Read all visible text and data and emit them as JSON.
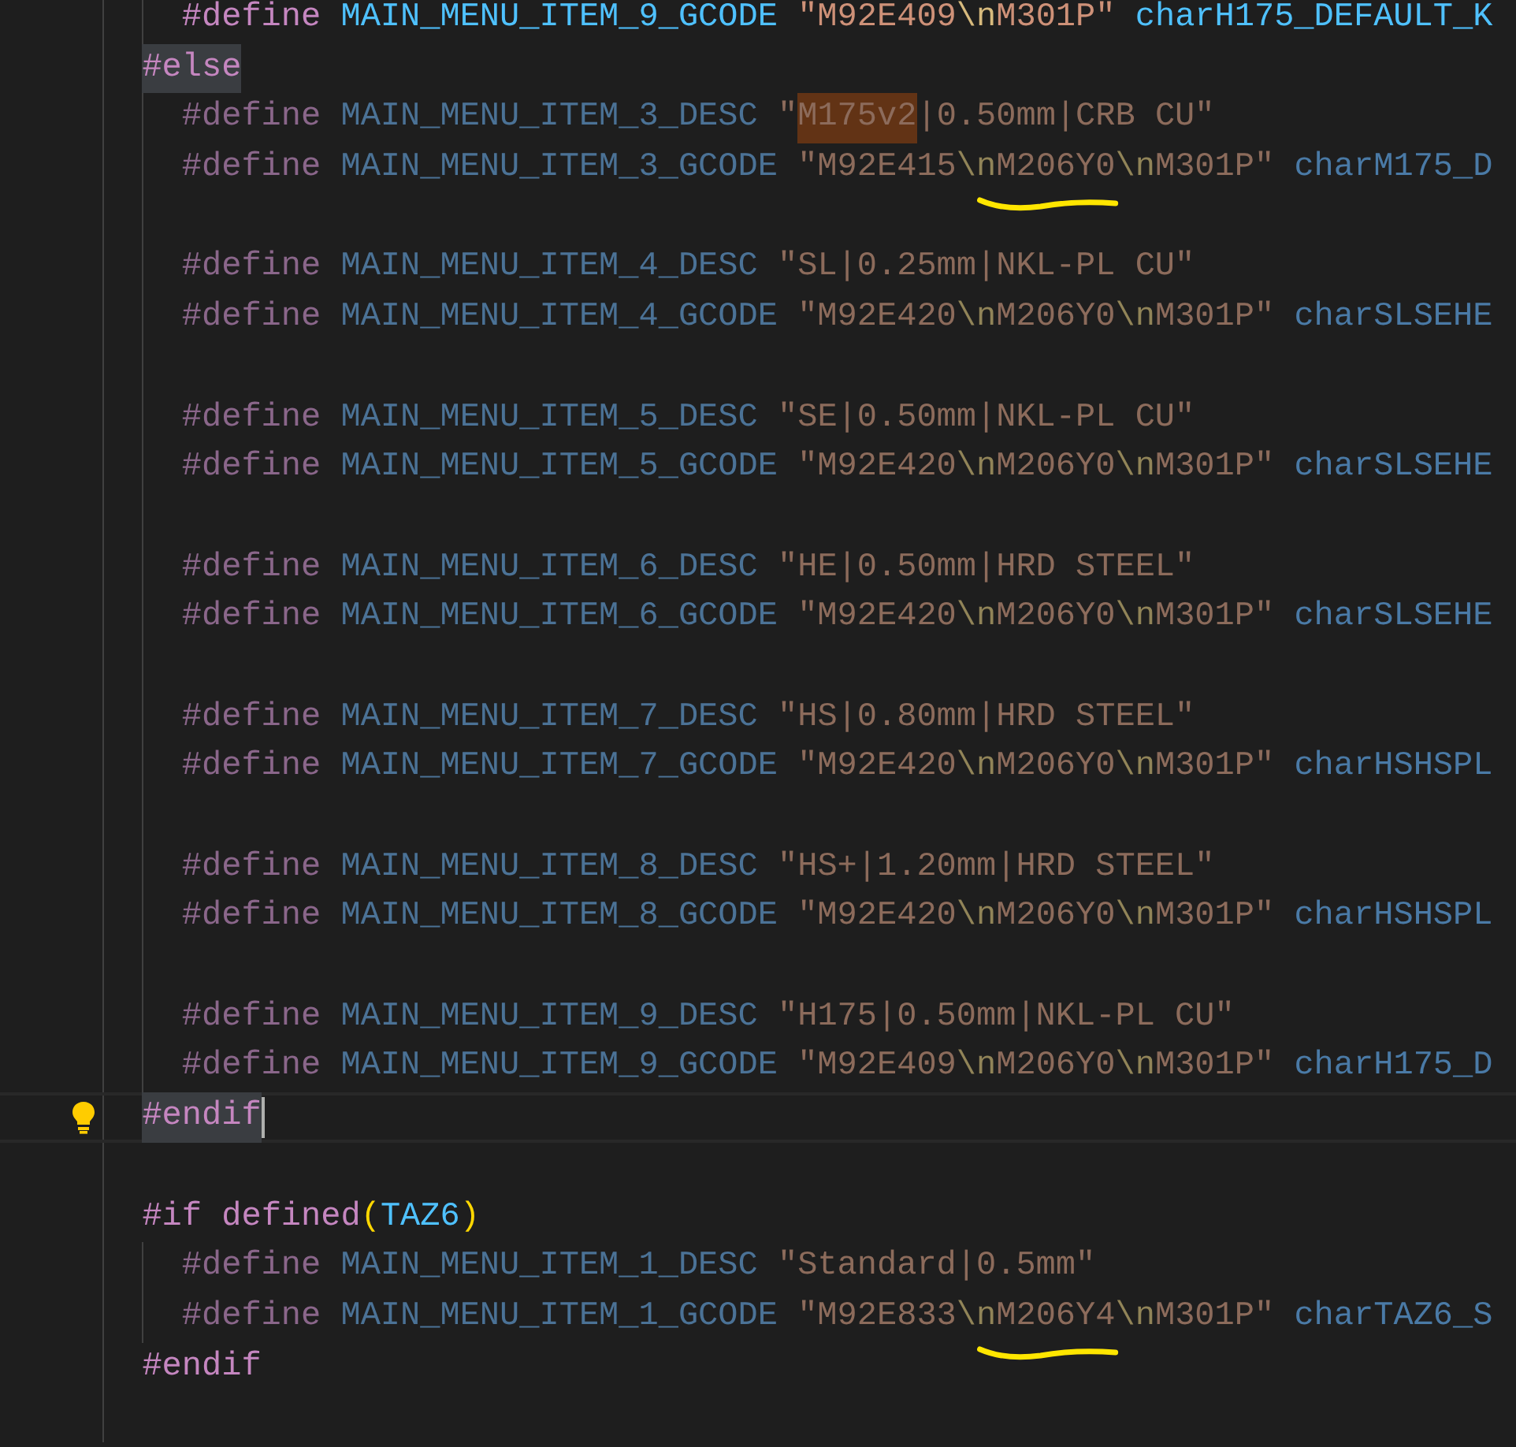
{
  "editor": {
    "lines": [
      {
        "kind": "code",
        "nested": true,
        "dimmed": false,
        "tokens": [
          {
            "kind": "directive",
            "text": "#define"
          },
          {
            "kind": "macro",
            "text": " MAIN_MENU_ITEM_9_GCODE"
          },
          {
            "kind": "string",
            "text": " \"M92E409"
          },
          {
            "kind": "escape",
            "text": "\\n"
          },
          {
            "kind": "string",
            "text": "M301P\""
          },
          {
            "kind": "identifier",
            "text": " charH175_DEFAULT_K"
          }
        ]
      },
      {
        "kind": "code",
        "nested": false,
        "dimmed": false,
        "tokens": [
          {
            "kind": "directive",
            "text": "#else",
            "word_highlight": true
          }
        ]
      },
      {
        "kind": "code",
        "nested": true,
        "dimmed": true,
        "tokens": [
          {
            "kind": "directive",
            "text": "#define"
          },
          {
            "kind": "macro",
            "text": " MAIN_MENU_ITEM_3_DESC"
          },
          {
            "kind": "string",
            "text": " \""
          },
          {
            "kind": "string",
            "text": "M175v2",
            "find_match": true
          },
          {
            "kind": "string",
            "text": "|0.50mm|CRB CU\""
          }
        ]
      },
      {
        "kind": "code",
        "nested": true,
        "dimmed": true,
        "tokens": [
          {
            "kind": "directive",
            "text": "#define"
          },
          {
            "kind": "macro",
            "text": " MAIN_MENU_ITEM_3_GCODE"
          },
          {
            "kind": "string",
            "text": " \"M92E415"
          },
          {
            "kind": "escape",
            "text": "\\n"
          },
          {
            "kind": "string",
            "text": "M206Y0",
            "underlined": true
          },
          {
            "kind": "escape",
            "text": "\\n"
          },
          {
            "kind": "string",
            "text": "M301P\""
          },
          {
            "kind": "identifier",
            "text": " charM175_D"
          }
        ]
      },
      {
        "kind": "blank"
      },
      {
        "kind": "code",
        "nested": true,
        "dimmed": true,
        "tokens": [
          {
            "kind": "directive",
            "text": "#define"
          },
          {
            "kind": "macro",
            "text": " MAIN_MENU_ITEM_4_DESC"
          },
          {
            "kind": "string",
            "text": " \"SL|0.25mm|NKL-PL CU\""
          }
        ]
      },
      {
        "kind": "code",
        "nested": true,
        "dimmed": true,
        "tokens": [
          {
            "kind": "directive",
            "text": "#define"
          },
          {
            "kind": "macro",
            "text": " MAIN_MENU_ITEM_4_GCODE"
          },
          {
            "kind": "string",
            "text": " \"M92E420"
          },
          {
            "kind": "escape",
            "text": "\\n"
          },
          {
            "kind": "string",
            "text": "M206Y0"
          },
          {
            "kind": "escape",
            "text": "\\n"
          },
          {
            "kind": "string",
            "text": "M301P\""
          },
          {
            "kind": "identifier",
            "text": " charSLSEHE"
          }
        ]
      },
      {
        "kind": "blank"
      },
      {
        "kind": "code",
        "nested": true,
        "dimmed": true,
        "tokens": [
          {
            "kind": "directive",
            "text": "#define"
          },
          {
            "kind": "macro",
            "text": " MAIN_MENU_ITEM_5_DESC"
          },
          {
            "kind": "string",
            "text": " \"SE|0.50mm|NKL-PL CU\""
          }
        ]
      },
      {
        "kind": "code",
        "nested": true,
        "dimmed": true,
        "tokens": [
          {
            "kind": "directive",
            "text": "#define"
          },
          {
            "kind": "macro",
            "text": " MAIN_MENU_ITEM_5_GCODE"
          },
          {
            "kind": "string",
            "text": " \"M92E420"
          },
          {
            "kind": "escape",
            "text": "\\n"
          },
          {
            "kind": "string",
            "text": "M206Y0"
          },
          {
            "kind": "escape",
            "text": "\\n"
          },
          {
            "kind": "string",
            "text": "M301P\""
          },
          {
            "kind": "identifier",
            "text": " charSLSEHE"
          }
        ]
      },
      {
        "kind": "blank"
      },
      {
        "kind": "code",
        "nested": true,
        "dimmed": true,
        "tokens": [
          {
            "kind": "directive",
            "text": "#define"
          },
          {
            "kind": "macro",
            "text": " MAIN_MENU_ITEM_6_DESC"
          },
          {
            "kind": "string",
            "text": " \"HE|0.50mm|HRD STEEL\""
          }
        ]
      },
      {
        "kind": "code",
        "nested": true,
        "dimmed": true,
        "tokens": [
          {
            "kind": "directive",
            "text": "#define"
          },
          {
            "kind": "macro",
            "text": " MAIN_MENU_ITEM_6_GCODE"
          },
          {
            "kind": "string",
            "text": " \"M92E420"
          },
          {
            "kind": "escape",
            "text": "\\n"
          },
          {
            "kind": "string",
            "text": "M206Y0"
          },
          {
            "kind": "escape",
            "text": "\\n"
          },
          {
            "kind": "string",
            "text": "M301P\""
          },
          {
            "kind": "identifier",
            "text": " charSLSEHE"
          }
        ]
      },
      {
        "kind": "blank"
      },
      {
        "kind": "code",
        "nested": true,
        "dimmed": true,
        "tokens": [
          {
            "kind": "directive",
            "text": "#define"
          },
          {
            "kind": "macro",
            "text": " MAIN_MENU_ITEM_7_DESC"
          },
          {
            "kind": "string",
            "text": " \"HS|0.80mm|HRD STEEL\""
          }
        ]
      },
      {
        "kind": "code",
        "nested": true,
        "dimmed": true,
        "tokens": [
          {
            "kind": "directive",
            "text": "#define"
          },
          {
            "kind": "macro",
            "text": " MAIN_MENU_ITEM_7_GCODE"
          },
          {
            "kind": "string",
            "text": " \"M92E420"
          },
          {
            "kind": "escape",
            "text": "\\n"
          },
          {
            "kind": "string",
            "text": "M206Y0"
          },
          {
            "kind": "escape",
            "text": "\\n"
          },
          {
            "kind": "string",
            "text": "M301P\""
          },
          {
            "kind": "identifier",
            "text": " charHSHSPL"
          }
        ]
      },
      {
        "kind": "blank"
      },
      {
        "kind": "code",
        "nested": true,
        "dimmed": true,
        "tokens": [
          {
            "kind": "directive",
            "text": "#define"
          },
          {
            "kind": "macro",
            "text": " MAIN_MENU_ITEM_8_DESC"
          },
          {
            "kind": "string",
            "text": " \"HS+|1.20mm|HRD STEEL\""
          }
        ]
      },
      {
        "kind": "code",
        "nested": true,
        "dimmed": true,
        "tokens": [
          {
            "kind": "directive",
            "text": "#define"
          },
          {
            "kind": "macro",
            "text": " MAIN_MENU_ITEM_8_GCODE"
          },
          {
            "kind": "string",
            "text": " \"M92E420"
          },
          {
            "kind": "escape",
            "text": "\\n"
          },
          {
            "kind": "string",
            "text": "M206Y0"
          },
          {
            "kind": "escape",
            "text": "\\n"
          },
          {
            "kind": "string",
            "text": "M301P\""
          },
          {
            "kind": "identifier",
            "text": " charHSHSPL"
          }
        ]
      },
      {
        "kind": "blank"
      },
      {
        "kind": "code",
        "nested": true,
        "dimmed": true,
        "tokens": [
          {
            "kind": "directive",
            "text": "#define"
          },
          {
            "kind": "macro",
            "text": " MAIN_MENU_ITEM_9_DESC"
          },
          {
            "kind": "string",
            "text": " \"H175|0.50mm|NKL-PL CU\""
          }
        ]
      },
      {
        "kind": "code",
        "nested": true,
        "dimmed": true,
        "tokens": [
          {
            "kind": "directive",
            "text": "#define"
          },
          {
            "kind": "macro",
            "text": " MAIN_MENU_ITEM_9_GCODE"
          },
          {
            "kind": "string",
            "text": " \"M92E409"
          },
          {
            "kind": "escape",
            "text": "\\n"
          },
          {
            "kind": "string",
            "text": "M206Y0"
          },
          {
            "kind": "escape",
            "text": "\\n"
          },
          {
            "kind": "string",
            "text": "M301P\""
          },
          {
            "kind": "identifier",
            "text": " charH175_D"
          }
        ]
      },
      {
        "kind": "code",
        "nested": false,
        "dimmed": false,
        "current": true,
        "lightbulb": true,
        "tokens": [
          {
            "kind": "directive",
            "text": "#endif",
            "word_highlight": true
          }
        ]
      },
      {
        "kind": "blank"
      },
      {
        "kind": "code",
        "nested": false,
        "dimmed": false,
        "tokens": [
          {
            "kind": "directive",
            "text": "#if"
          },
          {
            "kind": "directive",
            "text": " defined"
          },
          {
            "kind": "paren",
            "text": "("
          },
          {
            "kind": "macro",
            "text": "TAZ6"
          },
          {
            "kind": "paren",
            "text": ")"
          }
        ]
      },
      {
        "kind": "code",
        "nested": true,
        "dimmed": true,
        "tokens": [
          {
            "kind": "directive",
            "text": "#define"
          },
          {
            "kind": "macro",
            "text": " MAIN_MENU_ITEM_1_DESC"
          },
          {
            "kind": "string",
            "text": " \"Standard|0.5mm\""
          }
        ]
      },
      {
        "kind": "code",
        "nested": true,
        "dimmed": true,
        "tokens": [
          {
            "kind": "directive",
            "text": "#define"
          },
          {
            "kind": "macro",
            "text": " MAIN_MENU_ITEM_1_GCODE"
          },
          {
            "kind": "string",
            "text": " \"M92E833"
          },
          {
            "kind": "escape",
            "text": "\\n"
          },
          {
            "kind": "string",
            "text": "M206Y4",
            "underlined": true
          },
          {
            "kind": "escape",
            "text": "\\n"
          },
          {
            "kind": "string",
            "text": "M301P\""
          },
          {
            "kind": "identifier",
            "text": " charTAZ6_S"
          }
        ]
      },
      {
        "kind": "code",
        "nested": false,
        "dimmed": false,
        "tokens": [
          {
            "kind": "directive",
            "text": "#endif"
          }
        ]
      },
      {
        "kind": "blank"
      }
    ]
  }
}
